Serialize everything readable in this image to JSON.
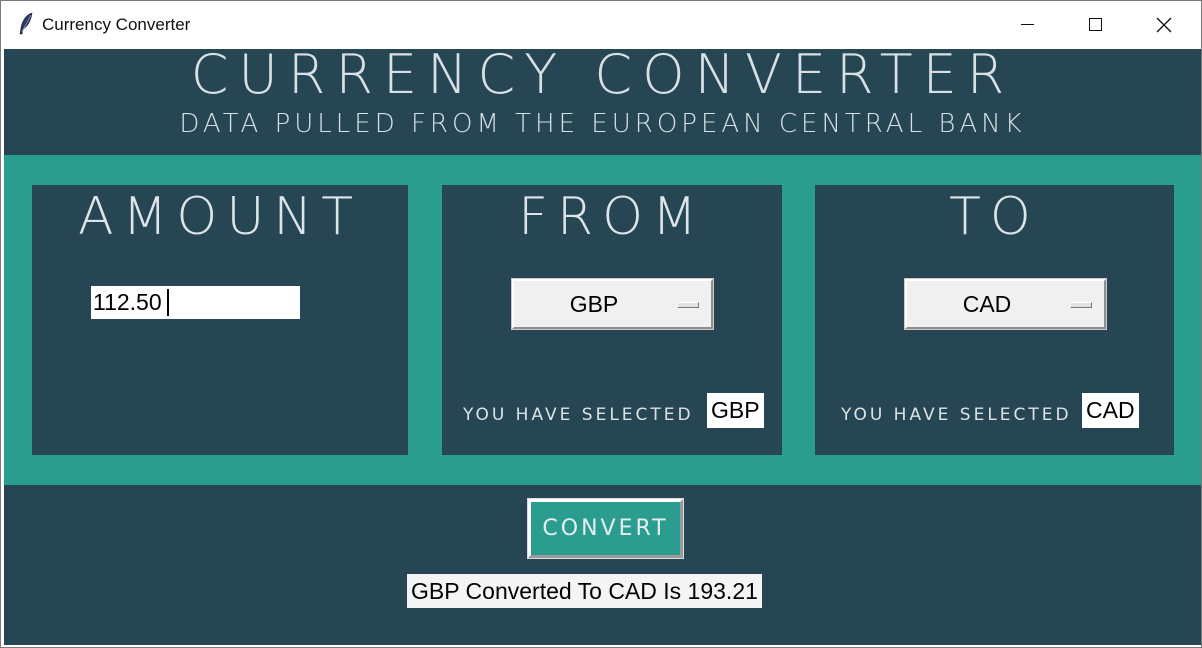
{
  "window": {
    "title": "Currency Converter",
    "controls": [
      "minimize-icon",
      "maximize-icon",
      "close-icon"
    ]
  },
  "header": {
    "title": "CURRENCY CONVERTER",
    "subtitle": "DATA PULLED FROM THE EUROPEAN CENTRAL BANK"
  },
  "amount": {
    "heading": "AMOUNT",
    "value": "112.50"
  },
  "from": {
    "heading": "FROM",
    "selected_option": "GBP",
    "selected_label": "YOU HAVE SELECTED",
    "selected_value": "GBP"
  },
  "to": {
    "heading": "TO",
    "selected_option": "CAD",
    "selected_label": "YOU HAVE SELECTED",
    "selected_value": "CAD"
  },
  "convert_button": "CONVERT",
  "result": "GBP Converted To CAD Is 193.21",
  "colors": {
    "background": "#264653",
    "accent": "#2a9d8f",
    "text_light": "#d7e0e4"
  }
}
